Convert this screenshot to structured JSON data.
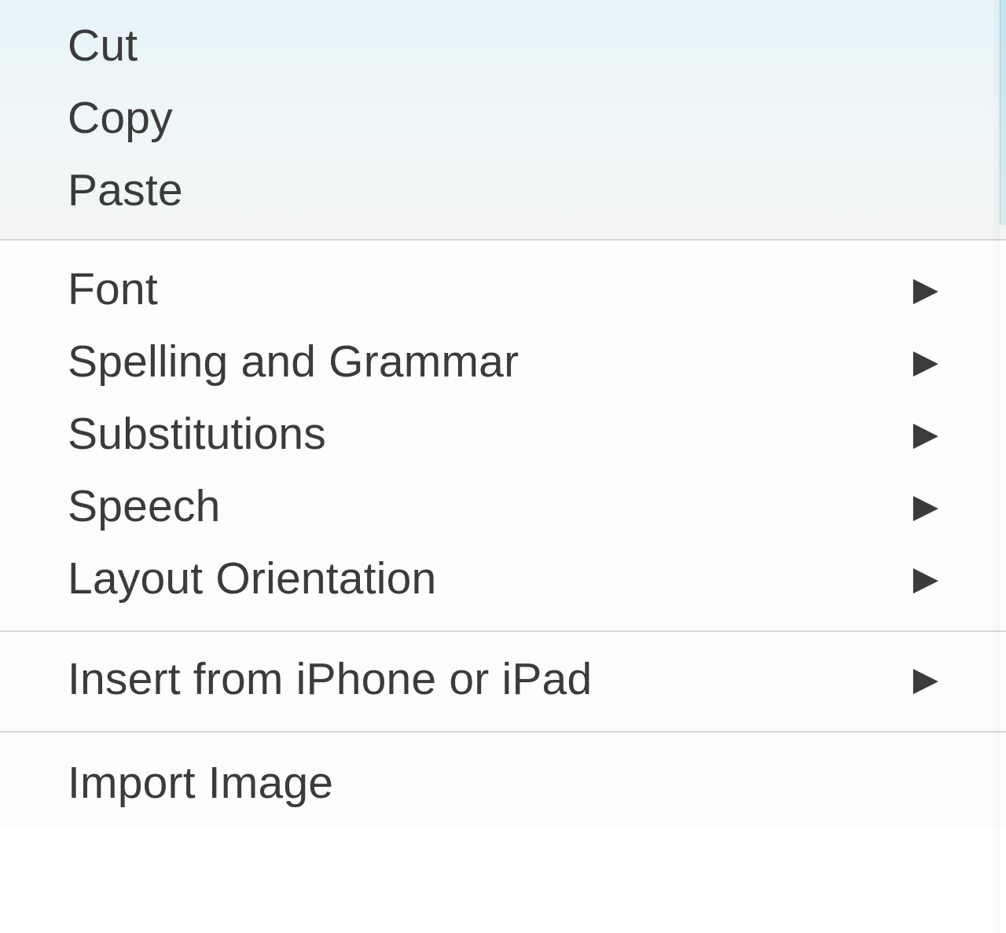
{
  "contextMenu": {
    "sections": [
      {
        "id": "clipboard",
        "items": [
          {
            "label": "Cut",
            "hasSubmenu": false
          },
          {
            "label": "Copy",
            "hasSubmenu": false
          },
          {
            "label": "Paste",
            "hasSubmenu": false
          }
        ]
      },
      {
        "id": "formatting",
        "items": [
          {
            "label": "Font",
            "hasSubmenu": true
          },
          {
            "label": "Spelling and Grammar",
            "hasSubmenu": true
          },
          {
            "label": "Substitutions",
            "hasSubmenu": true
          },
          {
            "label": "Speech",
            "hasSubmenu": true
          },
          {
            "label": "Layout Orientation",
            "hasSubmenu": true
          }
        ]
      },
      {
        "id": "continuity",
        "items": [
          {
            "label": "Insert from iPhone or iPad",
            "hasSubmenu": true
          }
        ]
      },
      {
        "id": "import",
        "items": [
          {
            "label": "Import Image",
            "hasSubmenu": false
          }
        ]
      }
    ]
  }
}
